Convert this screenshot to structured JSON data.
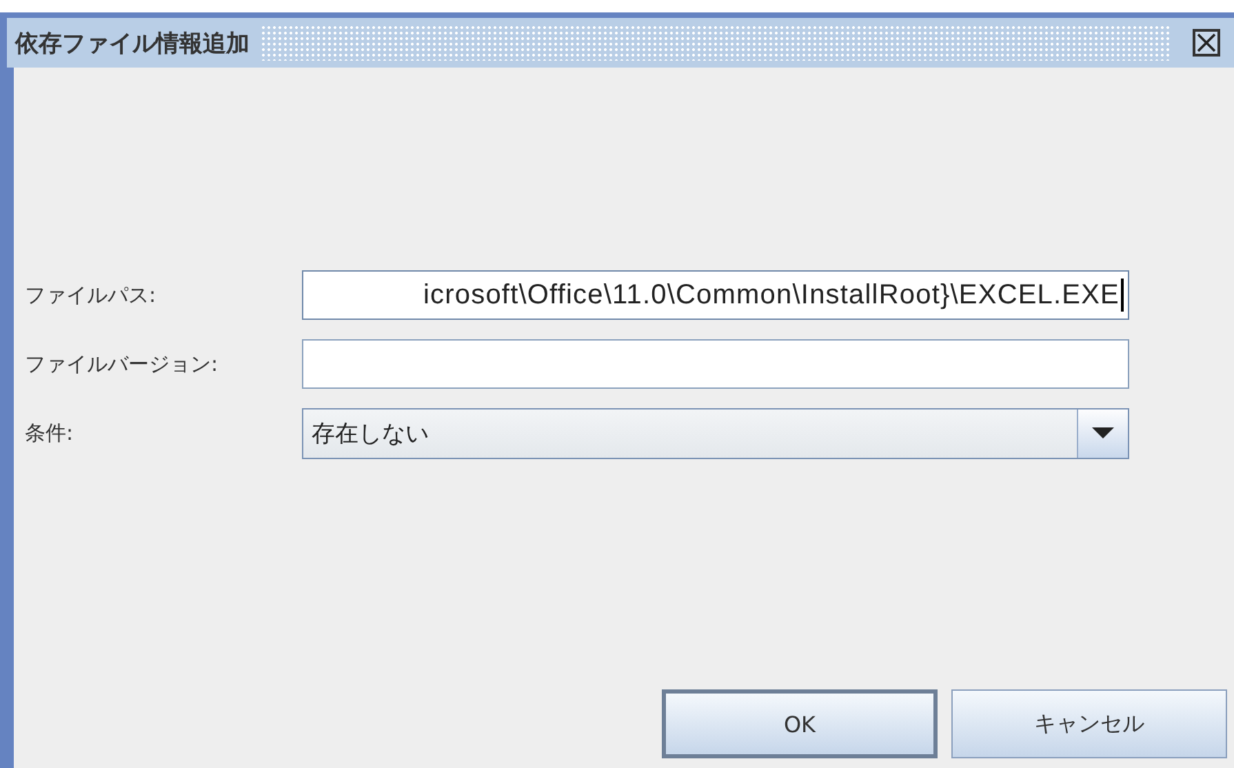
{
  "window": {
    "title": "依存ファイル情報追加"
  },
  "fields": [
    {
      "kind": "text",
      "label": "ファイルパス:",
      "value": "icrosoft\\Office\\11.0\\Common\\InstallRoot}\\EXCEL.EXE",
      "focused": true
    },
    {
      "kind": "text",
      "label": "ファイルバージョン:",
      "focused": false
    },
    {
      "kind": "combo",
      "label": "条件:",
      "value": "存在しない",
      "focused": false
    }
  ],
  "buttons": [
    {
      "label": "OK",
      "default": true
    },
    {
      "label": "キャンセル",
      "default": false
    }
  ]
}
